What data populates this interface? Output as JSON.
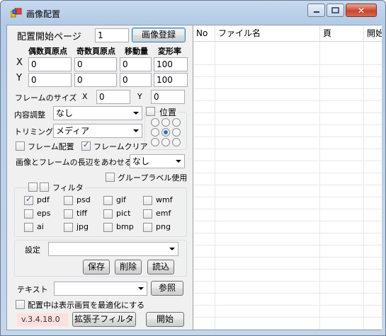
{
  "window": {
    "title": "画像配置"
  },
  "placement": {
    "start_page_label": "配置開始ページ",
    "start_page_value": "1",
    "register_button": "画像登録"
  },
  "origin": {
    "col_headers": [
      "偶数頁原点",
      "奇数頁原点",
      "移動量",
      "変形率"
    ],
    "x_label": "X",
    "y_label": "Y",
    "x_values": [
      "0",
      "0",
      "0",
      "100"
    ],
    "y_values": [
      "0",
      "0",
      "0",
      "100"
    ]
  },
  "frame_size": {
    "label": "フレームのサイズ",
    "x_label": "X",
    "x_value": "0",
    "y_label": "Y",
    "y_value": "0"
  },
  "content_fit": {
    "label": "内容調整",
    "value": "なし"
  },
  "trimming": {
    "label": "トリミング",
    "value": "メディア"
  },
  "position": {
    "label": "位置"
  },
  "frame_place": {
    "label": "フレーム配置",
    "checked": false
  },
  "frame_clear": {
    "label": "フレームクリア",
    "checked": true
  },
  "long_side": {
    "label": "画像とフレームの長辺をあわせる",
    "value": "なし"
  },
  "group_label": {
    "label": "グループラベル使用",
    "checked": false
  },
  "filter": {
    "label": "フィルタ",
    "types": [
      {
        "label": "pdf",
        "checked": true
      },
      {
        "label": "psd",
        "checked": false
      },
      {
        "label": "gif",
        "checked": false
      },
      {
        "label": "wmf",
        "checked": false
      },
      {
        "label": "eps",
        "checked": false
      },
      {
        "label": "tiff",
        "checked": false
      },
      {
        "label": "pict",
        "checked": false
      },
      {
        "label": "emf",
        "checked": false
      },
      {
        "label": "ai",
        "checked": false
      },
      {
        "label": "jpg",
        "checked": false
      },
      {
        "label": "bmp",
        "checked": false
      },
      {
        "label": "png",
        "checked": false
      }
    ]
  },
  "settings": {
    "label": "設定",
    "value": "",
    "save": "保存",
    "delete": "削除",
    "load": "読込"
  },
  "text": {
    "label": "テキスト",
    "value": "",
    "browse": "参照"
  },
  "optimize": {
    "label": "配置中は表示画質を最適化にする",
    "checked": false
  },
  "footer": {
    "version": "v.3.4.18.0",
    "ext_filter": "拡張子フィルタ",
    "start": "開始"
  },
  "table": {
    "headers": [
      "No",
      "ファイル名",
      "頁",
      "開始"
    ]
  }
}
